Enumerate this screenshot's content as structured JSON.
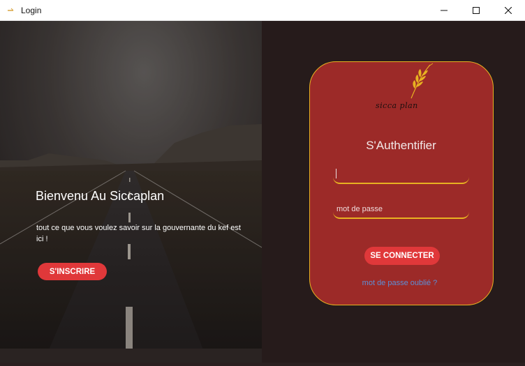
{
  "window": {
    "title": "Login"
  },
  "left": {
    "welcome_title": "Bienvenu Au Siccaplan",
    "welcome_text": "tout ce que vous voulez savoir sur la gouvernante du kef est ici   !",
    "signup_label": "S'INSCRIRE"
  },
  "card": {
    "logo_text": "sicca plan",
    "title": "S'Authentifier",
    "username_value": "",
    "password_placeholder": "mot de passe",
    "connect_label": "SE CONNECTER",
    "forgot_label": "mot de passe oublié ?"
  },
  "colors": {
    "accent_red": "#e0383a",
    "card_red": "#9c2a28",
    "gold_border": "#e8b221",
    "link_blue": "#5d8fd6",
    "dark_background": "#261b1b"
  }
}
